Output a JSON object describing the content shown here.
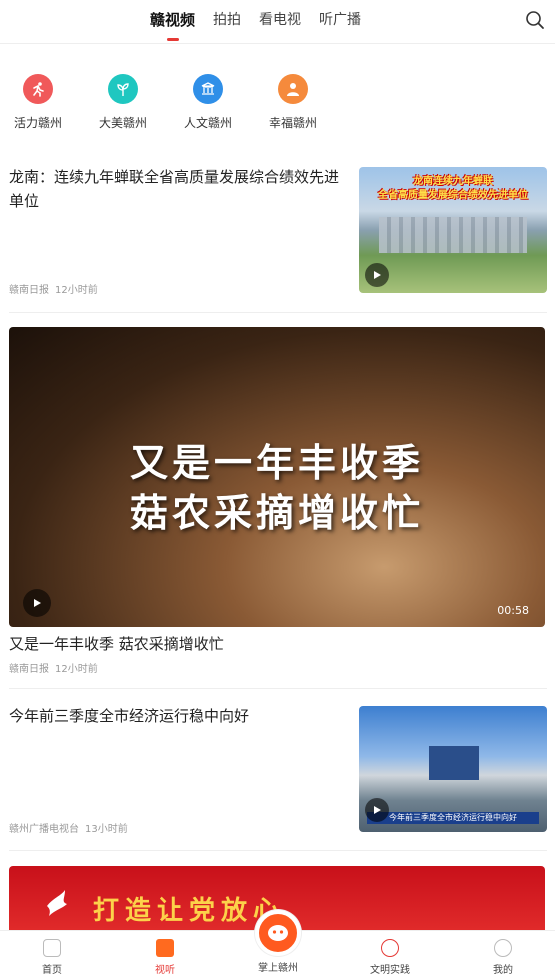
{
  "tabs": [
    {
      "label": "赣视频",
      "active": true
    },
    {
      "label": "拍拍",
      "active": false
    },
    {
      "label": "看电视",
      "active": false
    },
    {
      "label": "听广播",
      "active": false
    }
  ],
  "categories": [
    {
      "label": "活力赣州",
      "icon": "running-icon",
      "color": "#f0595a"
    },
    {
      "label": "大美赣州",
      "icon": "plant-icon",
      "color": "#1fc7c0"
    },
    {
      "label": "人文赣州",
      "icon": "culture-icon",
      "color": "#2f8fe8"
    },
    {
      "label": "幸福赣州",
      "icon": "person-icon",
      "color": "#f58a3c"
    }
  ],
  "articles": [
    {
      "title": "龙南：连续九年蝉联全省高质量发展综合绩效先进单位",
      "source": "赣南日报",
      "time": "12小时前",
      "thumb_caption_1": "龙南连续九年蝉联",
      "thumb_caption_2": "全省高质量发展综合绩效先进单位"
    },
    {
      "title": "又是一年丰收季  菇农采摘增收忙",
      "source": "赣南日报",
      "time": "12小时前",
      "duration": "00:58",
      "caption_line1": "又是一年丰收季",
      "caption_line2": "菇农采摘增收忙"
    },
    {
      "title": "今年前三季度全市经济运行稳中向好",
      "source": "赣州广播电视台",
      "time": "13小时前",
      "thumb_caption": "今年前三季度全市经济运行稳中向好"
    },
    {
      "banner_text": "打造让党放心"
    }
  ],
  "bottom_nav": [
    {
      "label": "首页",
      "active": false
    },
    {
      "label": "视听",
      "active": true
    },
    {
      "label": "掌上赣州",
      "active": false
    },
    {
      "label": "文明实践",
      "active": false
    },
    {
      "label": "我的",
      "active": false
    }
  ],
  "colors": {
    "accent": "#e53935",
    "center": "#ff5a1f"
  }
}
